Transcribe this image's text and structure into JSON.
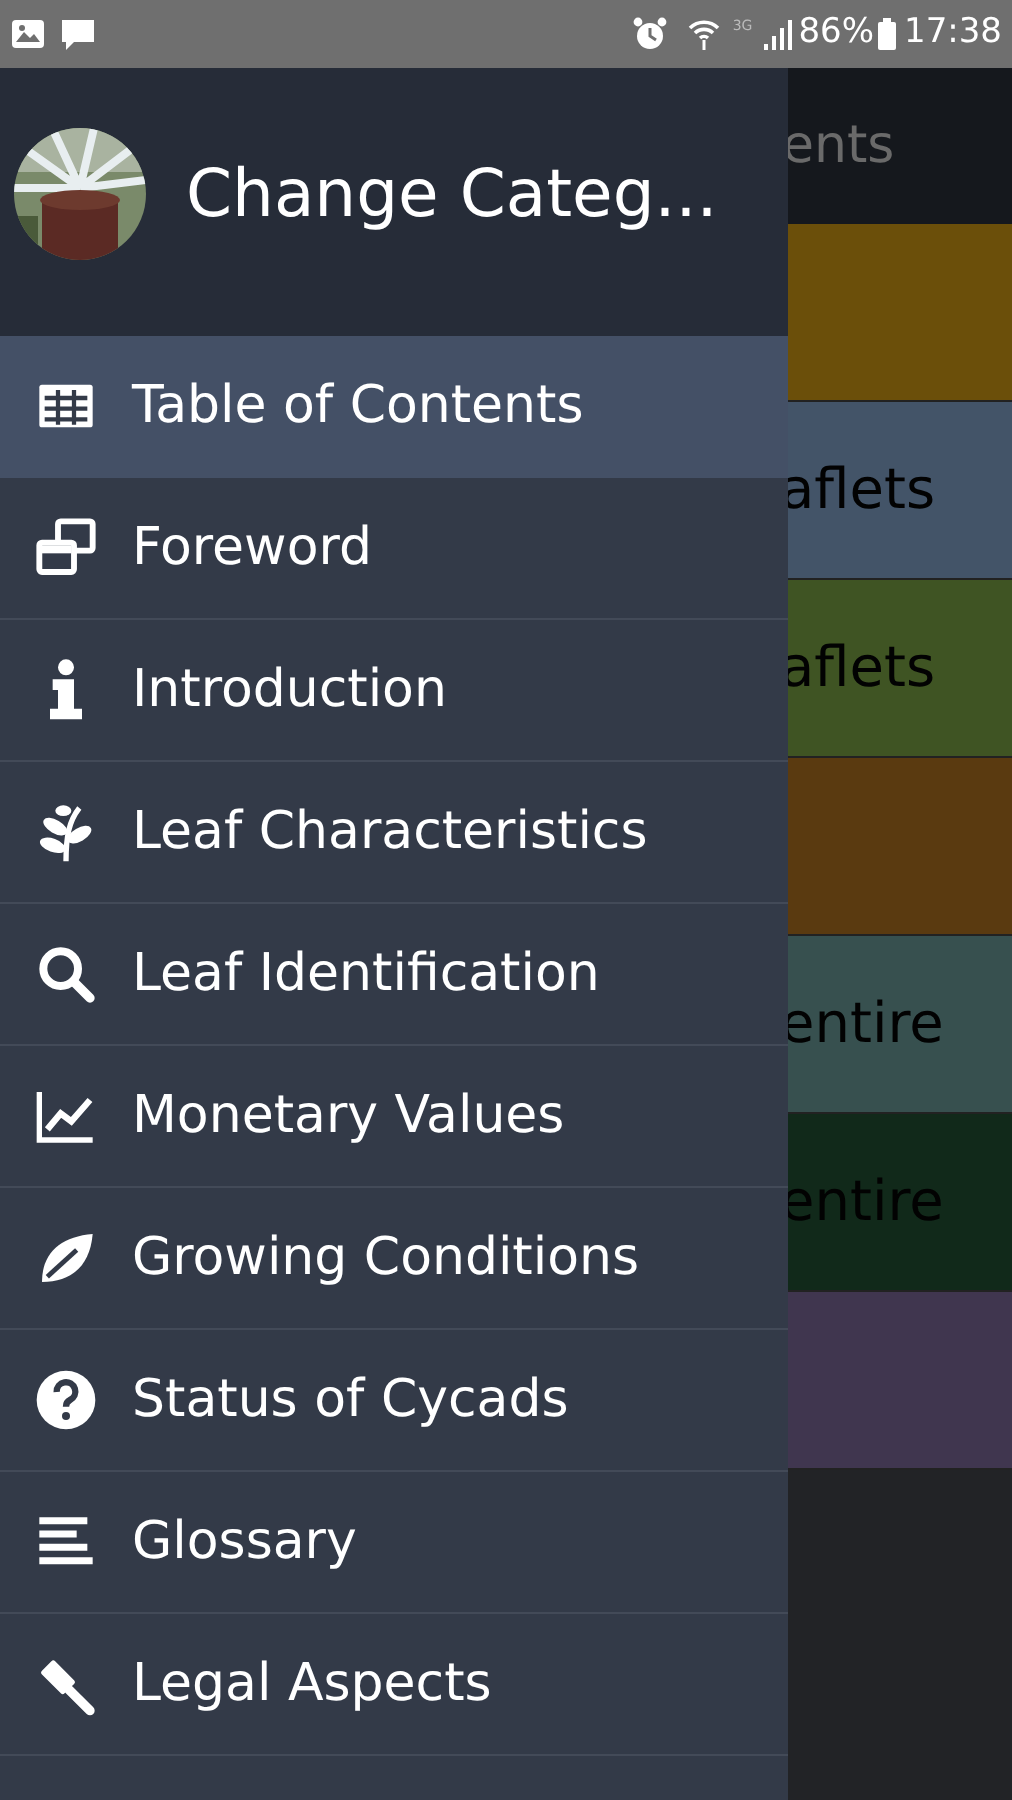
{
  "status_bar": {
    "network": "3G",
    "battery": "86%",
    "time": "17:38"
  },
  "background_screen": {
    "title": "ents",
    "rows": [
      {
        "color": "#6b4f0a"
      },
      {
        "label": "aflets",
        "color": "#435468"
      },
      {
        "label": "aflets",
        "color": "#3f5423"
      },
      {
        "color": "#5a3a10"
      },
      {
        "label": "entire",
        "color": "#37504f"
      },
      {
        "label": "entire",
        "color": "#11291a"
      },
      {
        "color": "#40364f"
      }
    ]
  },
  "drawer": {
    "header": {
      "title": "Change Categ..."
    },
    "items": [
      {
        "label": "Table of Contents",
        "selected": true
      },
      {
        "label": "Foreword",
        "selected": false
      },
      {
        "label": "Introduction",
        "selected": false
      },
      {
        "label": "Leaf Characteristics",
        "selected": false
      },
      {
        "label": "Leaf Identification",
        "selected": false
      },
      {
        "label": "Monetary Values",
        "selected": false
      },
      {
        "label": "Growing Conditions",
        "selected": false
      },
      {
        "label": "Status of Cycads",
        "selected": false
      },
      {
        "label": "Glossary",
        "selected": false
      },
      {
        "label": "Legal Aspects",
        "selected": false
      }
    ]
  }
}
